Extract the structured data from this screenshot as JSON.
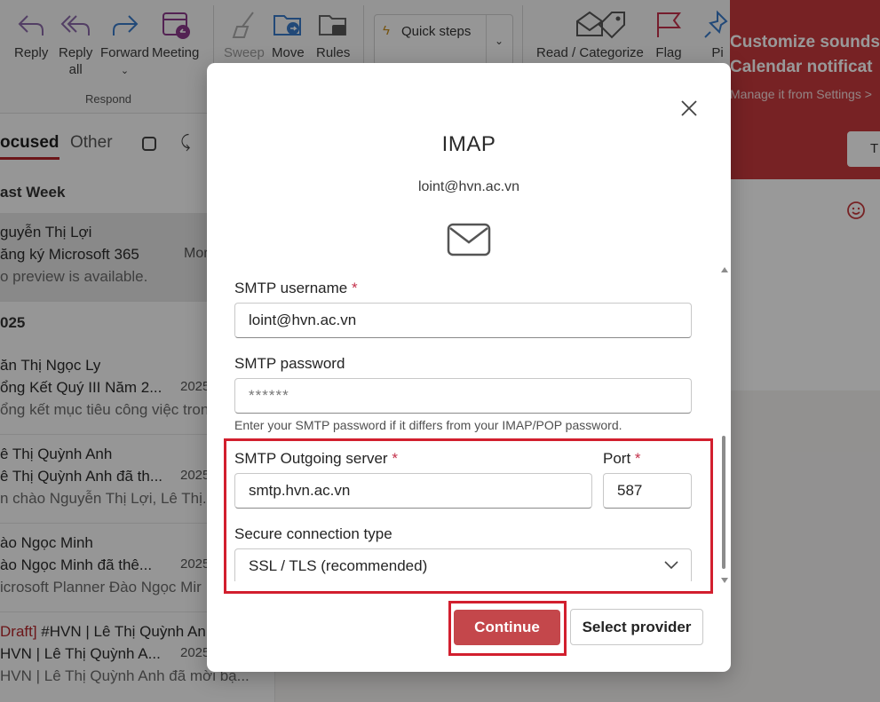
{
  "ribbon": {
    "reply": "Reply",
    "reply_all_1": "Reply",
    "reply_all_2": "all",
    "forward": "Forward",
    "meeting": "Meeting",
    "group_respond": "Respond",
    "sweep": "Sweep",
    "move": "Move",
    "rules": "Rules",
    "quick_steps": "Quick steps",
    "read_unread": "Read / Categorize",
    "flag": "Flag",
    "pin": "Pi"
  },
  "maillist": {
    "tab_focused": "ocused",
    "tab_other": "Other",
    "section_last_week": "ast Week",
    "section_2025": "025",
    "items": [
      {
        "l1": "guyễn Thị Lợi",
        "l2": "ăng ký Microsoft 365",
        "l2_tail": "Mor",
        "l3": "o preview is available.",
        "date": ""
      },
      {
        "l1": "ăn Thị Ngọc Ly",
        "l2": "ổng Kết Quý III Năm 2...",
        "l3": "ổng kết mục tiêu công việc tron",
        "date": "2025"
      },
      {
        "l1": "ê Thị Quỳnh Anh",
        "l2": "ê Thị Quỳnh Anh đã th...",
        "l3": "n chào Nguyễn Thị Lợi, Lê Thị...",
        "date": "2025"
      },
      {
        "l1": "ào Ngọc Minh",
        "l2": "ào Ngọc Minh đã thê...",
        "l3": "icrosoft Planner Đào Ngọc Mir",
        "date": "2025"
      },
      {
        "l1_draft": "Draft]",
        "l1": " #HVN | Lê Thị Quỳnh Anh",
        "l2": "HVN | Lê Thị Quỳnh A...",
        "l3": "HVN | Lê Thị Quỳnh Anh đã mời bạ...",
        "date": "2025"
      }
    ]
  },
  "tip": {
    "title_1": "Customize sounds",
    "title_2": "Calendar notificat",
    "subtitle": "Manage it from Settings >",
    "button": "T"
  },
  "dialog": {
    "title": "IMAP",
    "email": "loint@hvn.ac.vn",
    "smtp_username_label": "SMTP username",
    "smtp_username_value": "loint@hvn.ac.vn",
    "smtp_password_label": "SMTP password",
    "smtp_password_placeholder": "******",
    "smtp_password_hint": "Enter your SMTP password if it differs from your IMAP/POP password.",
    "smtp_server_label": "SMTP Outgoing server",
    "smtp_server_value": "smtp.hvn.ac.vn",
    "port_label": "Port",
    "port_value": "587",
    "secure_label": "Secure connection type",
    "secure_value": "SSL / TLS (recommended)",
    "required_mark": "*",
    "continue": "Continue",
    "select_provider": "Select provider"
  },
  "colors": {
    "accent": "#c4474b",
    "highlight": "#d21f2e",
    "tip_bg": "#c7393c"
  }
}
